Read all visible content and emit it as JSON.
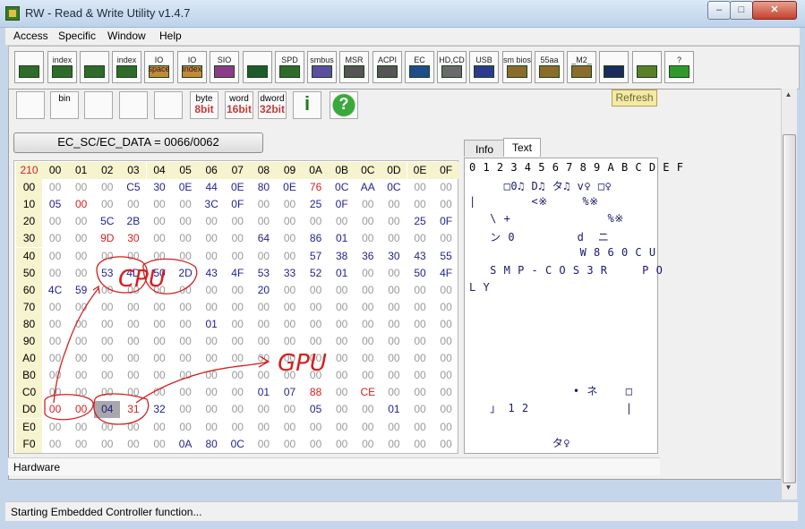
{
  "window": {
    "title": "RW - Read & Write Utility v1.4.7",
    "min_glyph": "–",
    "max_glyph": "□",
    "close_glyph": "✕"
  },
  "menu": [
    "Access",
    "Specific",
    "Window",
    "Help"
  ],
  "toolbar": [
    {
      "name": "pci-tool",
      "label": "",
      "color": "#2f6b2a"
    },
    {
      "name": "pci-index-tool",
      "label": "index",
      "color": "#2f6b2a"
    },
    {
      "name": "memory-tool",
      "label": "",
      "color": "#2f6b2a"
    },
    {
      "name": "memory-index-tool",
      "label": "index",
      "color": "#2f6b2a"
    },
    {
      "name": "io-space-tool",
      "label": "IO space",
      "color": "#c4883a"
    },
    {
      "name": "io-index-tool",
      "label": "IO index",
      "color": "#c4883a"
    },
    {
      "name": "sio-tool",
      "label": "SIO",
      "color": "#8b3a8b"
    },
    {
      "name": "clock-tool",
      "label": "",
      "color": "#1c5c2c"
    },
    {
      "name": "spd-tool",
      "label": "SPD",
      "color": "#2f6b2a"
    },
    {
      "name": "smbus-tool",
      "label": "smbus",
      "color": "#5a4fa2"
    },
    {
      "name": "msr-tool",
      "label": "MSR",
      "color": "#555555"
    },
    {
      "name": "acpi-tool",
      "label": "ACPI",
      "color": "#555555"
    },
    {
      "name": "ec-tool",
      "label": "EC",
      "color": "#1d4e8a"
    },
    {
      "name": "hdd-cd-tool",
      "label": "HD,CD",
      "color": "#6a6a6a"
    },
    {
      "name": "usb-tool",
      "label": "USB",
      "color": "#2d3b8e"
    },
    {
      "name": "smbios-tool",
      "label": "sm bios",
      "color": "#8a6d2a"
    },
    {
      "name": "55aa-tool",
      "label": "55aa",
      "color": "#8a6d2a"
    },
    {
      "name": "m2-tool",
      "label": "_M2_",
      "color": "#8a6d2a"
    },
    {
      "name": "command-tool",
      "label": "",
      "color": "#1b2b5c"
    },
    {
      "name": "battery-tool",
      "label": "",
      "color": "#5a7f2a"
    },
    {
      "name": "help-tool",
      "label": "?",
      "color": "#2e9a2e"
    }
  ],
  "subtoolbar": [
    {
      "name": "save-tool",
      "l1": "",
      "l2": ""
    },
    {
      "name": "bin-tool",
      "l1": "bin",
      "l2": ""
    },
    {
      "name": "copy-tool",
      "l1": "",
      "l2": ""
    },
    {
      "name": "find-tool",
      "l1": "",
      "l2": ""
    },
    {
      "name": "table-tool",
      "l1": "",
      "l2": ""
    },
    {
      "name": "byte-tool",
      "l1": "byte",
      "l2": "8bit"
    },
    {
      "name": "word-tool",
      "l1": "word",
      "l2": "16bit"
    },
    {
      "name": "dword-tool",
      "l1": "dword",
      "l2": "32bit"
    },
    {
      "name": "info-tool",
      "l1": "i",
      "l2": ""
    },
    {
      "name": "help-tool-2",
      "l1": "?",
      "l2": ""
    }
  ],
  "refresh_label": "Refresh",
  "address_label": "EC_SC/EC_DATA = 0066/0062",
  "grid": {
    "corner": "210",
    "cols": [
      "00",
      "01",
      "02",
      "03",
      "04",
      "05",
      "06",
      "07",
      "08",
      "09",
      "0A",
      "0B",
      "0C",
      "0D",
      "0E",
      "0F"
    ],
    "rows": [
      {
        "addr": "00",
        "cells": [
          "00",
          "00",
          "00",
          "C5",
          "30",
          "0E",
          "44",
          "0E",
          "80",
          "0E",
          "76",
          "0C",
          "AA",
          "0C",
          "00",
          "00"
        ],
        "colors": [
          "g",
          "g",
          "g",
          "b",
          "b",
          "b",
          "b",
          "b",
          "b",
          "b",
          "r",
          "b",
          "b",
          "b",
          "g",
          "g"
        ]
      },
      {
        "addr": "10",
        "cells": [
          "05",
          "00",
          "00",
          "00",
          "00",
          "00",
          "3C",
          "0F",
          "00",
          "00",
          "25",
          "0F",
          "00",
          "00",
          "00",
          "00"
        ],
        "colors": [
          "b",
          "r",
          "g",
          "g",
          "g",
          "g",
          "b",
          "b",
          "g",
          "g",
          "b",
          "b",
          "g",
          "g",
          "g",
          "g"
        ]
      },
      {
        "addr": "20",
        "cells": [
          "00",
          "00",
          "5C",
          "2B",
          "00",
          "00",
          "00",
          "00",
          "00",
          "00",
          "00",
          "00",
          "00",
          "00",
          "25",
          "0F"
        ],
        "colors": [
          "g",
          "g",
          "b",
          "b",
          "g",
          "g",
          "g",
          "g",
          "g",
          "g",
          "g",
          "g",
          "g",
          "g",
          "b",
          "b"
        ]
      },
      {
        "addr": "30",
        "cells": [
          "00",
          "00",
          "9D",
          "30",
          "00",
          "00",
          "00",
          "00",
          "64",
          "00",
          "86",
          "01",
          "00",
          "00",
          "00",
          "00"
        ],
        "colors": [
          "g",
          "g",
          "r",
          "r",
          "g",
          "g",
          "g",
          "g",
          "b",
          "g",
          "b",
          "b",
          "g",
          "g",
          "g",
          "g"
        ]
      },
      {
        "addr": "40",
        "cells": [
          "00",
          "00",
          "00",
          "00",
          "00",
          "00",
          "00",
          "00",
          "00",
          "00",
          "57",
          "38",
          "36",
          "30",
          "43",
          "55"
        ],
        "colors": [
          "g",
          "g",
          "g",
          "g",
          "g",
          "g",
          "g",
          "g",
          "g",
          "g",
          "b",
          "b",
          "b",
          "b",
          "b",
          "b"
        ]
      },
      {
        "addr": "50",
        "cells": [
          "00",
          "00",
          "53",
          "4D",
          "50",
          "2D",
          "43",
          "4F",
          "53",
          "33",
          "52",
          "01",
          "00",
          "00",
          "50",
          "4F"
        ],
        "colors": [
          "g",
          "g",
          "b",
          "b",
          "b",
          "b",
          "b",
          "b",
          "b",
          "b",
          "b",
          "b",
          "g",
          "g",
          "b",
          "b"
        ]
      },
      {
        "addr": "60",
        "cells": [
          "4C",
          "59",
          "00",
          "00",
          "00",
          "00",
          "00",
          "00",
          "20",
          "00",
          "00",
          "00",
          "00",
          "00",
          "00",
          "00"
        ],
        "colors": [
          "b",
          "b",
          "g",
          "g",
          "g",
          "g",
          "g",
          "g",
          "b",
          "g",
          "g",
          "g",
          "g",
          "g",
          "g",
          "g"
        ]
      },
      {
        "addr": "70",
        "cells": [
          "00",
          "00",
          "00",
          "00",
          "00",
          "00",
          "00",
          "00",
          "00",
          "00",
          "00",
          "00",
          "00",
          "00",
          "00",
          "00"
        ],
        "colors": [
          "g",
          "g",
          "g",
          "g",
          "g",
          "g",
          "g",
          "g",
          "g",
          "g",
          "g",
          "g",
          "g",
          "g",
          "g",
          "g"
        ]
      },
      {
        "addr": "80",
        "cells": [
          "00",
          "00",
          "00",
          "00",
          "00",
          "00",
          "01",
          "00",
          "00",
          "00",
          "00",
          "00",
          "00",
          "00",
          "00",
          "00"
        ],
        "colors": [
          "g",
          "g",
          "g",
          "g",
          "g",
          "g",
          "b",
          "g",
          "g",
          "g",
          "g",
          "g",
          "g",
          "g",
          "g",
          "g"
        ]
      },
      {
        "addr": "90",
        "cells": [
          "00",
          "00",
          "00",
          "00",
          "00",
          "00",
          "00",
          "00",
          "00",
          "00",
          "00",
          "00",
          "00",
          "00",
          "00",
          "00"
        ],
        "colors": [
          "g",
          "g",
          "g",
          "g",
          "g",
          "g",
          "g",
          "g",
          "g",
          "g",
          "g",
          "g",
          "g",
          "g",
          "g",
          "g"
        ]
      },
      {
        "addr": "A0",
        "cells": [
          "00",
          "00",
          "00",
          "00",
          "00",
          "00",
          "00",
          "00",
          "00",
          "00",
          "00",
          "00",
          "00",
          "00",
          "00",
          "00"
        ],
        "colors": [
          "g",
          "g",
          "g",
          "g",
          "g",
          "g",
          "g",
          "g",
          "g",
          "g",
          "g",
          "g",
          "g",
          "g",
          "g",
          "g"
        ]
      },
      {
        "addr": "B0",
        "cells": [
          "00",
          "00",
          "00",
          "00",
          "00",
          "00",
          "00",
          "00",
          "00",
          "00",
          "00",
          "00",
          "00",
          "00",
          "00",
          "00"
        ],
        "colors": [
          "g",
          "g",
          "g",
          "g",
          "g",
          "g",
          "g",
          "g",
          "g",
          "g",
          "g",
          "g",
          "g",
          "g",
          "g",
          "g"
        ]
      },
      {
        "addr": "C0",
        "cells": [
          "00",
          "00",
          "00",
          "00",
          "00",
          "00",
          "00",
          "00",
          "01",
          "07",
          "88",
          "00",
          "CE",
          "00",
          "00",
          "00"
        ],
        "colors": [
          "g",
          "g",
          "g",
          "g",
          "g",
          "g",
          "g",
          "g",
          "b",
          "b",
          "r",
          "g",
          "r",
          "g",
          "g",
          "g"
        ]
      },
      {
        "addr": "D0",
        "cells": [
          "00",
          "00",
          "04",
          "31",
          "32",
          "00",
          "00",
          "00",
          "00",
          "00",
          "05",
          "00",
          "00",
          "01",
          "00",
          "00"
        ],
        "colors": [
          "r",
          "r",
          "s",
          "r",
          "b",
          "g",
          "g",
          "g",
          "g",
          "g",
          "b",
          "g",
          "g",
          "b",
          "g",
          "g"
        ]
      },
      {
        "addr": "E0",
        "cells": [
          "00",
          "00",
          "00",
          "00",
          "00",
          "00",
          "00",
          "00",
          "00",
          "00",
          "00",
          "00",
          "00",
          "00",
          "00",
          "00"
        ],
        "colors": [
          "g",
          "g",
          "g",
          "g",
          "g",
          "g",
          "g",
          "g",
          "g",
          "g",
          "g",
          "g",
          "g",
          "g",
          "g",
          "g"
        ]
      },
      {
        "addr": "F0",
        "cells": [
          "00",
          "00",
          "00",
          "00",
          "00",
          "0A",
          "80",
          "0C",
          "00",
          "00",
          "00",
          "00",
          "00",
          "00",
          "00",
          "00"
        ],
        "colors": [
          "g",
          "g",
          "g",
          "g",
          "g",
          "b",
          "b",
          "b",
          "g",
          "g",
          "g",
          "g",
          "g",
          "g",
          "g",
          "g"
        ]
      }
    ]
  },
  "tabs": [
    "Info",
    "Text"
  ],
  "text_panel": {
    "header": "0 1 2 3 4 5 6 7 8 9 A B C D E F",
    "lines": [
      "     □0♫ D♫ タ♫ v♀ □♀",
      "|        <※     %※",
      "   \\ +              %※",
      "   ン 0         d  ニ",
      "                W 8 6 0 C U",
      "   S M P - C O S 3 R     P O",
      "L Y",
      "",
      "",
      "",
      "",
      "",
      "               • ネ    □",
      "   」 1 2              |",
      "",
      "            タ♀"
    ]
  },
  "annotations": {
    "cpu": "CPU",
    "gpu": "GPU"
  },
  "hardware_label": "Hardware",
  "status": "Starting Embedded Controller function..."
}
